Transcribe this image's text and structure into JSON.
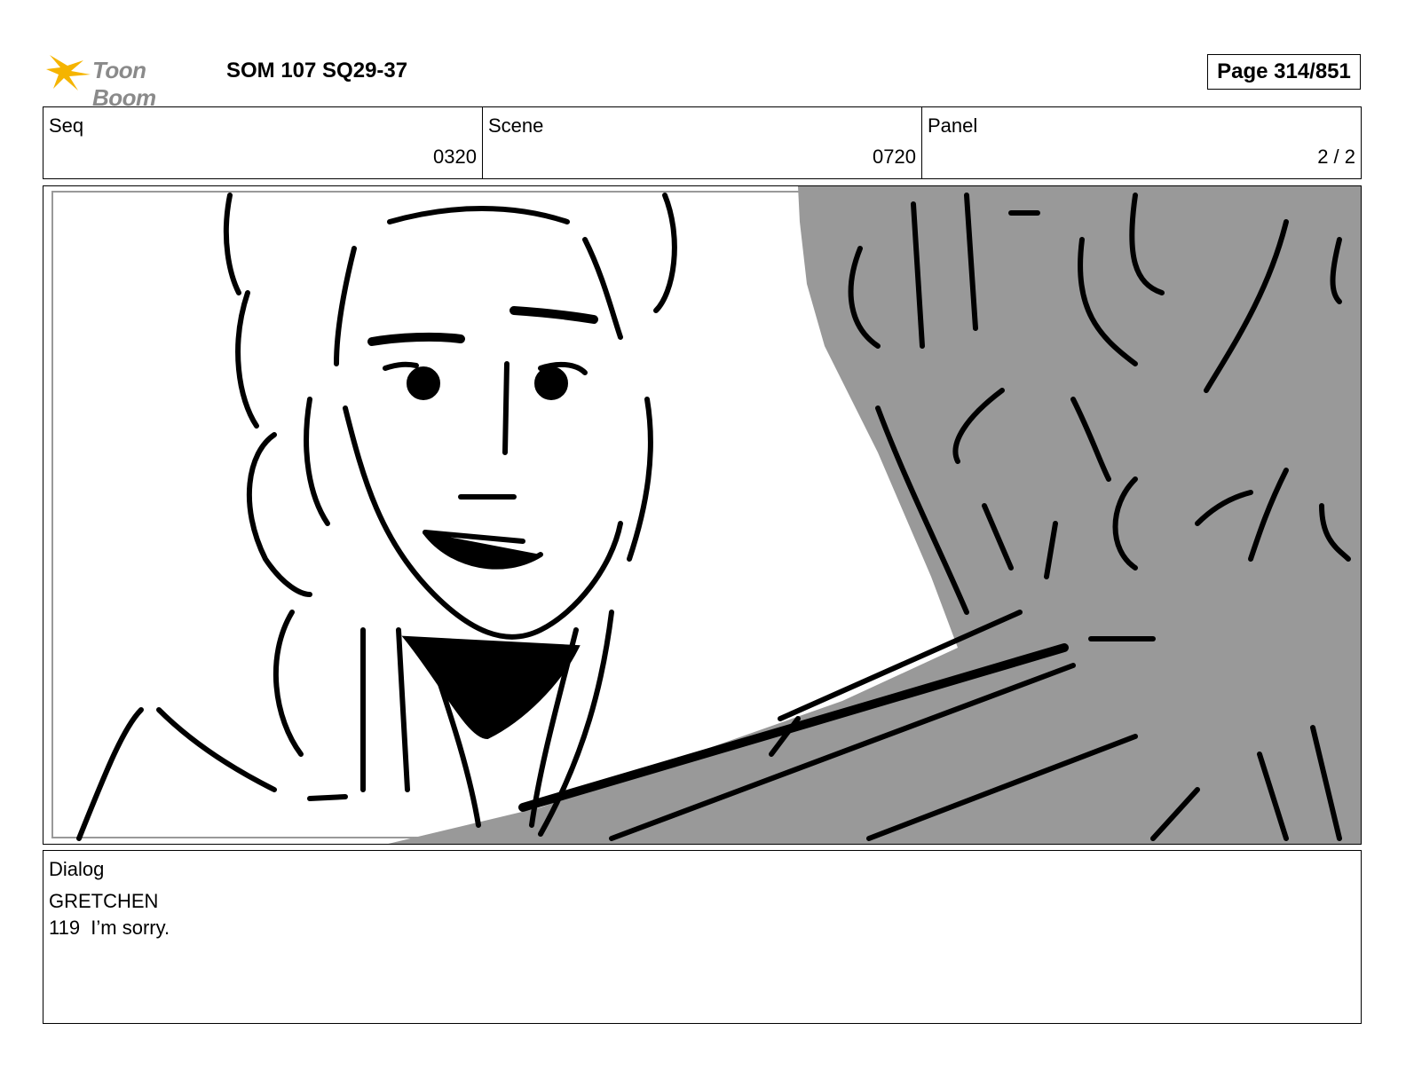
{
  "header": {
    "logo_text": "Toon Boom",
    "document_title": "SOM 107 SQ29-37",
    "page_label": "Page 314/851"
  },
  "info": {
    "seq_label": "Seq",
    "seq_value": "0320",
    "scene_label": "Scene",
    "scene_value": "0720",
    "panel_label": "Panel",
    "panel_value": "2 / 2"
  },
  "dialog": {
    "label": "Dialog",
    "character": "GRETCHEN",
    "line": "119  I’m sorry."
  },
  "colors": {
    "logo_star": "#f5b400",
    "logo_text": "#8a8a8a",
    "sketch_fill": "#999999"
  }
}
